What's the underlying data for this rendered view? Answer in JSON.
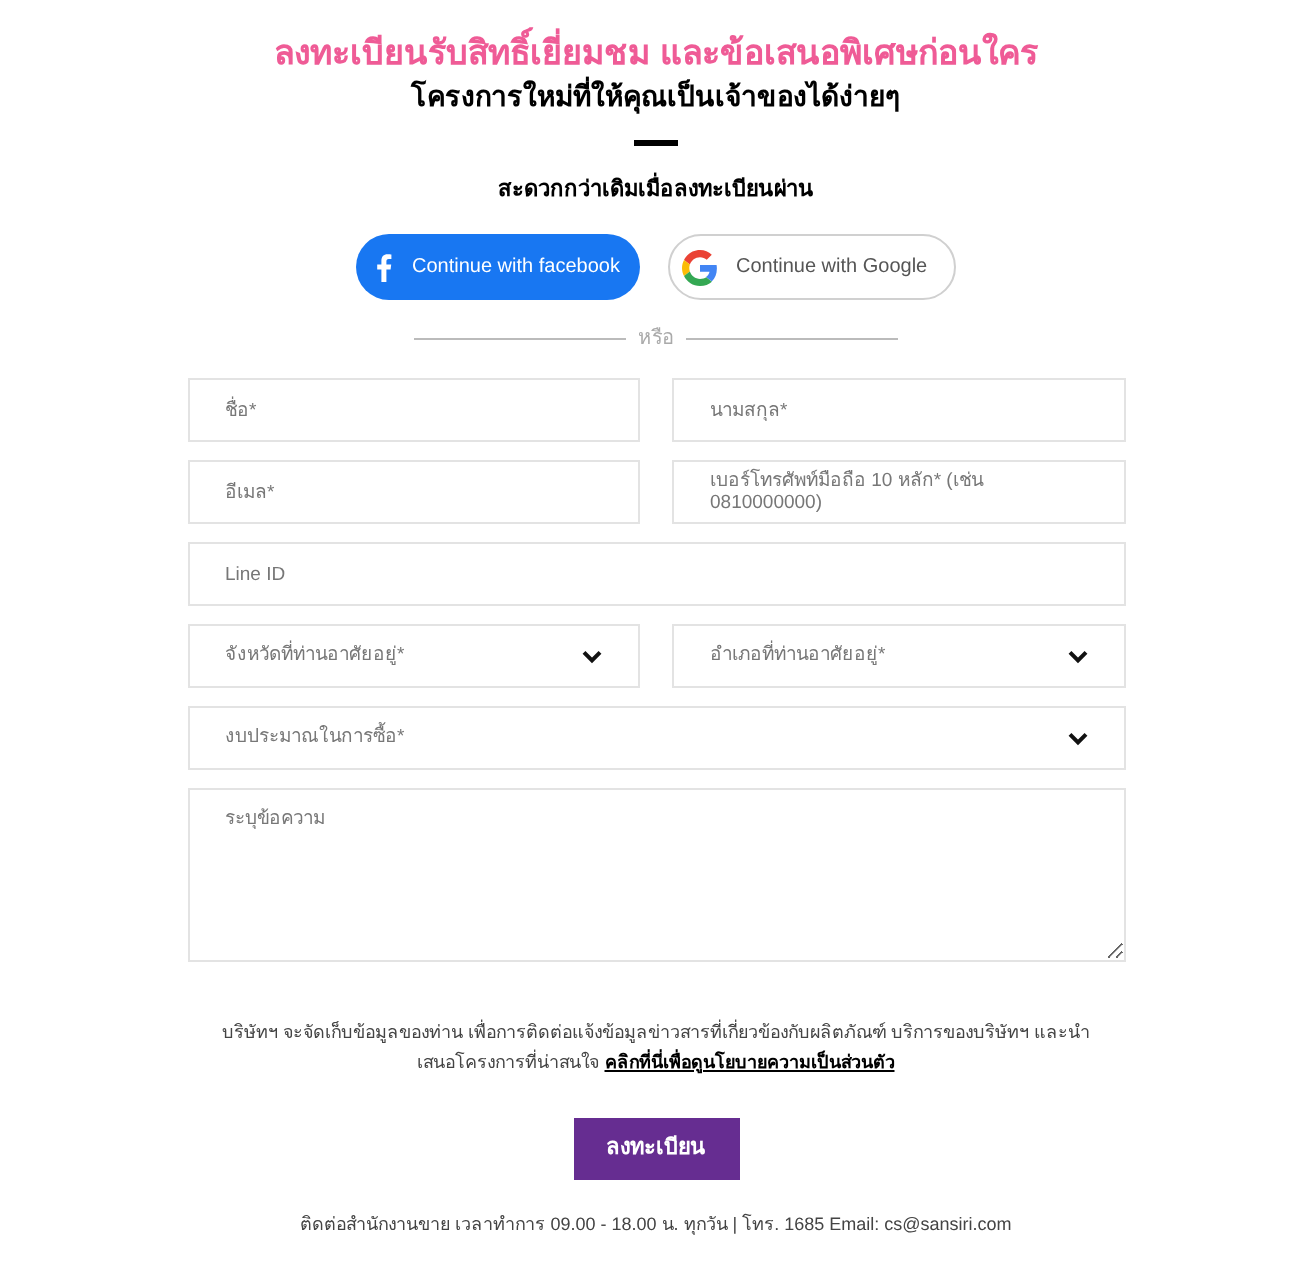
{
  "heading": {
    "title": "ลงทะเบียนรับสิทธิ์เยี่ยมชม และข้อเสนอพิเศษก่อนใคร",
    "subtitle": "โครงการใหม่ที่ให้คุณเป็นเจ้าของได้ง่ายๆ"
  },
  "social_prompt": "สะดวกกว่าเดิมเมื่อลงทะเบียนผ่าน",
  "social_buttons": [
    {
      "kind": "facebook",
      "label": "Continue with facebook"
    },
    {
      "kind": "google",
      "label": "Continue with Google"
    }
  ],
  "divider_label": "หรือ",
  "form_rows": [
    {
      "fields": [
        {
          "kind": "text",
          "placeholder": "ชื่อ*"
        },
        {
          "kind": "text",
          "placeholder": "นามสกุล*"
        }
      ]
    },
    {
      "fields": [
        {
          "kind": "text",
          "placeholder": "อีเมล*"
        },
        {
          "kind": "text",
          "placeholder": "เบอร์โทรศัพท์มือถือ 10 หลัก* (เช่น 0810000000)"
        }
      ]
    },
    {
      "fields": [
        {
          "kind": "text",
          "placeholder": "Line ID"
        }
      ]
    },
    {
      "fields": [
        {
          "kind": "select",
          "placeholder": "จังหวัดที่ท่านอาศัยอยู่*"
        },
        {
          "kind": "select",
          "placeholder": "อำเภอที่ท่านอาศัยอยู่*"
        }
      ]
    },
    {
      "fields": [
        {
          "kind": "select",
          "placeholder": "งบประมาณในการซื้อ*"
        }
      ]
    },
    {
      "fields": [
        {
          "kind": "textarea",
          "placeholder": "ระบุข้อความ"
        }
      ]
    }
  ],
  "consent": {
    "text": "บริษัทฯ จะจัดเก็บข้อมูลของท่าน เพื่อการติดต่อแจ้งข้อมูลข่าวสารที่เกี่ยวข้องกับผลิตภัณฑ์ บริการของบริษัทฯ และนำเสนอโครงการที่น่าสนใจ",
    "link": "คลิกที่นี่เพื่อดูนโยบายความเป็นส่วนตัว"
  },
  "submit_button": "ลงทะเบียน",
  "footer": "ติดต่อสำนักงานขาย เวลาทำการ 09.00 - 18.00 น. ทุกวัน | โทร. 1685 Email: cs@sansiri.com"
}
